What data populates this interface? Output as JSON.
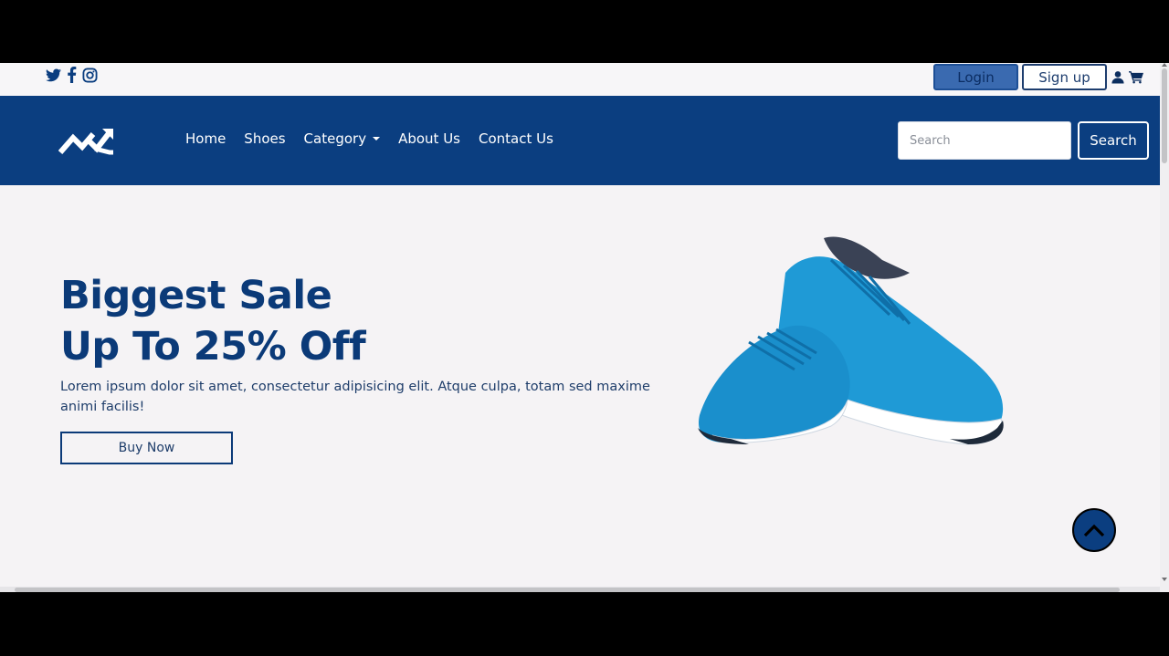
{
  "topbar": {
    "socials": [
      "twitter-icon",
      "facebook-icon",
      "instagram-icon"
    ],
    "login_label": "Login",
    "signup_label": "Sign up",
    "user_icon": "user-icon",
    "cart_icon": "cart-icon"
  },
  "navbar": {
    "brand_icon": "trend-arrow-logo",
    "links": [
      "Home",
      "Shoes",
      "Category",
      "About Us",
      "Contact Us"
    ],
    "search_placeholder": "Search",
    "search_button": "Search"
  },
  "hero": {
    "title_line1": "Biggest Sale",
    "title_line2": "Up To 25% Off",
    "description": "Lorem ipsum dolor sit amet, consectetur adipisicing elit. Atque culpa, totam sed maxime animi facilis!",
    "cta": "Buy Now"
  },
  "colors": {
    "primary": "#0b3e80",
    "background": "#f5f3f5",
    "heading": "#0b3a78",
    "shoe": "#1f9ad6"
  }
}
